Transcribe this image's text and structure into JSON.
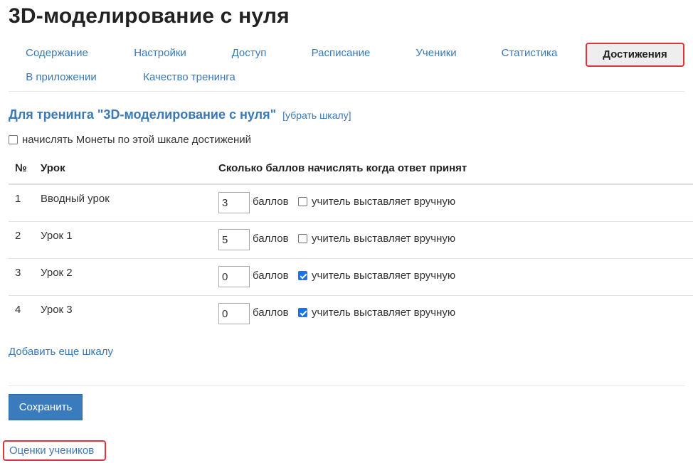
{
  "page": {
    "title": "3D-моделирование с нуля"
  },
  "tabs": [
    {
      "label": "Содержание",
      "active": false
    },
    {
      "label": "Настройки",
      "active": false
    },
    {
      "label": "Доступ",
      "active": false
    },
    {
      "label": "Расписание",
      "active": false
    },
    {
      "label": "Ученики",
      "active": false
    },
    {
      "label": "Статистика",
      "active": false
    },
    {
      "label": "Достижения",
      "active": true
    },
    {
      "label": "В приложении",
      "active": false
    },
    {
      "label": "Качество тренинга",
      "active": false
    }
  ],
  "scale": {
    "title": "Для тренинга \"3D-моделирование с нуля\"",
    "remove_link": "[убрать шкалу]",
    "coins_label": "начислять Монеты по этой шкале достижений",
    "coins_checked": false
  },
  "table": {
    "headers": {
      "num": "№",
      "lesson": "Урок",
      "points": "Сколько баллов начислять когда ответ принят"
    },
    "unit": "баллов",
    "manual_label": "учитель выставляет вручную",
    "rows": [
      {
        "num": "1",
        "lesson": "Вводный урок",
        "points": "3",
        "manual": false
      },
      {
        "num": "2",
        "lesson": "Урок 1",
        "points": "5",
        "manual": false
      },
      {
        "num": "3",
        "lesson": "Урок 2",
        "points": "0",
        "manual": true
      },
      {
        "num": "4",
        "lesson": "Урок 3",
        "points": "0",
        "manual": true
      }
    ]
  },
  "actions": {
    "add_scale": "Добавить еще шкалу",
    "save": "Сохранить",
    "grades": "Оценки учеников"
  },
  "colors": {
    "link": "#3b78b5",
    "highlight": "#e0343a",
    "button": "#3a7bbd"
  }
}
